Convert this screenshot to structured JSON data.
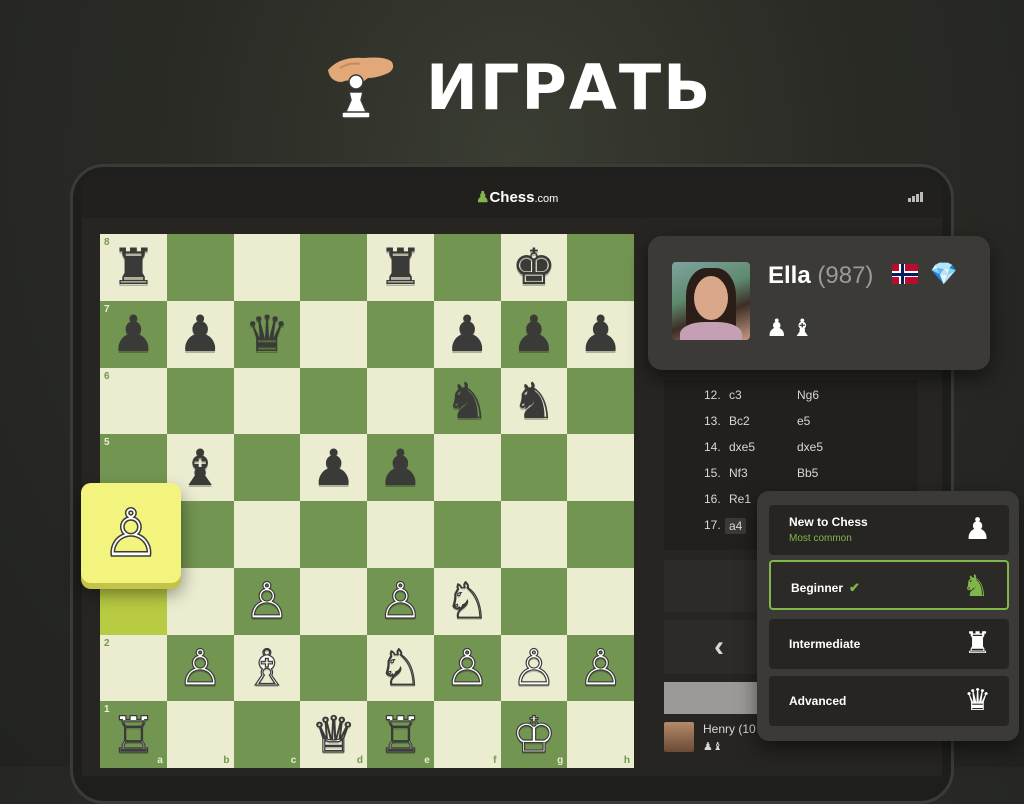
{
  "banner": {
    "title": "ИГРАТЬ",
    "icon": "hand-holding-pawn-icon"
  },
  "app": {
    "logo_pawn": "♟",
    "logo_name": "Chess",
    "logo_suffix": ".com",
    "signal_icon": "signal-bars-icon"
  },
  "board": {
    "ranks": [
      "8",
      "7",
      "6",
      "5",
      "4",
      "3",
      "2",
      "1"
    ],
    "files": [
      "a",
      "b",
      "c",
      "d",
      "e",
      "f",
      "g",
      "h"
    ],
    "light_color": "#ebecd0",
    "dark_color": "#739552",
    "highlight_color": "#b9ca43",
    "highlighted_square": "a3",
    "pieces": [
      {
        "sq": "a8",
        "p": "♜",
        "c": "black"
      },
      {
        "sq": "e8",
        "p": "♜",
        "c": "black"
      },
      {
        "sq": "g8",
        "p": "♚",
        "c": "black"
      },
      {
        "sq": "a7",
        "p": "♟",
        "c": "black"
      },
      {
        "sq": "b7",
        "p": "♟",
        "c": "black"
      },
      {
        "sq": "c7",
        "p": "♛",
        "c": "black"
      },
      {
        "sq": "f7",
        "p": "♟",
        "c": "black"
      },
      {
        "sq": "g7",
        "p": "♟",
        "c": "black"
      },
      {
        "sq": "h7",
        "p": "♟",
        "c": "black"
      },
      {
        "sq": "f6",
        "p": "♞",
        "c": "black"
      },
      {
        "sq": "g6",
        "p": "♞",
        "c": "black"
      },
      {
        "sq": "b5",
        "p": "♝",
        "c": "black"
      },
      {
        "sq": "d5",
        "p": "♟",
        "c": "black"
      },
      {
        "sq": "e5",
        "p": "♟",
        "c": "black"
      },
      {
        "sq": "c3",
        "p": "♙",
        "c": "white"
      },
      {
        "sq": "e3",
        "p": "♙",
        "c": "white"
      },
      {
        "sq": "f3",
        "p": "♘",
        "c": "white"
      },
      {
        "sq": "b2",
        "p": "♙",
        "c": "white"
      },
      {
        "sq": "c2",
        "p": "♗",
        "c": "white"
      },
      {
        "sq": "e2",
        "p": "♘",
        "c": "white"
      },
      {
        "sq": "f2",
        "p": "♙",
        "c": "white"
      },
      {
        "sq": "g2",
        "p": "♙",
        "c": "white"
      },
      {
        "sq": "h2",
        "p": "♙",
        "c": "white"
      },
      {
        "sq": "a1",
        "p": "♖",
        "c": "white"
      },
      {
        "sq": "d1",
        "p": "♕",
        "c": "white"
      },
      {
        "sq": "e1",
        "p": "♖",
        "c": "white"
      },
      {
        "sq": "g1",
        "p": "♔",
        "c": "white"
      }
    ],
    "dragged_piece": "♙"
  },
  "opponent": {
    "name": "Ella",
    "rating": "(987)",
    "flag": "norway-flag-icon",
    "badge": "💎",
    "captured": "♟♝"
  },
  "moves": [
    {
      "num": "12.",
      "white": "c3",
      "black": "Ng6"
    },
    {
      "num": "13.",
      "white": "Bc2",
      "black": "e5"
    },
    {
      "num": "14.",
      "white": "dxe5",
      "black": "dxe5"
    },
    {
      "num": "15.",
      "white": "Nf3",
      "black": "Bb5"
    },
    {
      "num": "16.",
      "white": "Re1",
      "black": ""
    },
    {
      "num": "17.",
      "white": "a4",
      "black": ""
    }
  ],
  "controls": {
    "back_label": "‹"
  },
  "player": {
    "name": "Henry",
    "rating_partial": "(10",
    "captured": "♟♝"
  },
  "levels": [
    {
      "label": "New to Chess",
      "sub": "Most common",
      "icon": "♟",
      "selected": false
    },
    {
      "label": "Beginner",
      "sub": "",
      "icon": "♞",
      "selected": true,
      "check": "✔"
    },
    {
      "label": "Intermediate",
      "sub": "",
      "icon": "♜",
      "selected": false
    },
    {
      "label": "Advanced",
      "sub": "",
      "icon": "♛",
      "selected": false
    }
  ]
}
